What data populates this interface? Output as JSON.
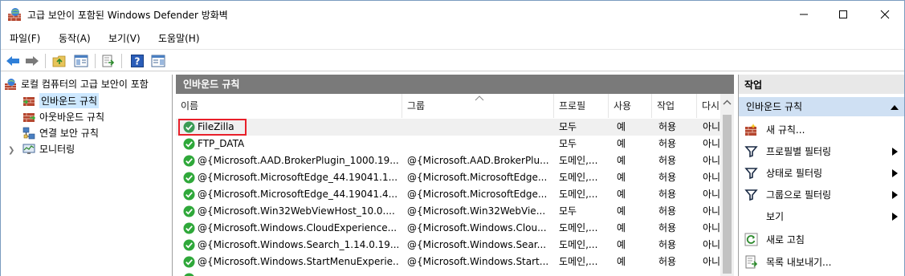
{
  "window": {
    "title": "고급 보안이 포함된 Windows Defender 방화벽"
  },
  "menu": [
    "파일(F)",
    "동작(A)",
    "보기(V)",
    "도움말(H)"
  ],
  "tree": {
    "root": "로컬 컴퓨터의 고급 보안이 포함",
    "items": [
      "인바운드 규칙",
      "아웃바운드 규칙",
      "연결 보안 규칙",
      "모니터링"
    ]
  },
  "center": {
    "header": "인바운드 규칙",
    "columns": [
      "이름",
      "그룹",
      "프로필",
      "사용",
      "작업",
      "다시"
    ],
    "rows": [
      {
        "name": "FileZilla",
        "group": "",
        "profile": "모두",
        "enabled": "예",
        "action": "허용",
        "override": "아니"
      },
      {
        "name": "FTP_DATA",
        "group": "",
        "profile": "모두",
        "enabled": "예",
        "action": "허용",
        "override": "아니"
      },
      {
        "name": "@{Microsoft.AAD.BrokerPlugin_1000.19...",
        "group": "@{Microsoft.AAD.BrokerPlu...",
        "profile": "도메인,...",
        "enabled": "예",
        "action": "허용",
        "override": "아니"
      },
      {
        "name": "@{Microsoft.MicrosoftEdge_44.19041.1....",
        "group": "@{Microsoft.MicrosoftEdge...",
        "profile": "도메인,...",
        "enabled": "예",
        "action": "허용",
        "override": "아니"
      },
      {
        "name": "@{Microsoft.MicrosoftEdge_44.19041.4....",
        "group": "@{Microsoft.MicrosoftEdge...",
        "profile": "도메인,...",
        "enabled": "예",
        "action": "허용",
        "override": "아니"
      },
      {
        "name": "@{Microsoft.Win32WebViewHost_10.0....",
        "group": "@{Microsoft.Win32WebVie...",
        "profile": "모두",
        "enabled": "예",
        "action": "허용",
        "override": "아니"
      },
      {
        "name": "@{Microsoft.Windows.CloudExperience...",
        "group": "@{Microsoft.Windows.Clou...",
        "profile": "도메인,...",
        "enabled": "예",
        "action": "허용",
        "override": "아니"
      },
      {
        "name": "@{Microsoft.Windows.Search_1.14.0.19...",
        "group": "@{Microsoft.Windows.Sear...",
        "profile": "도메인,...",
        "enabled": "예",
        "action": "허용",
        "override": "아니"
      },
      {
        "name": "@{Microsoft.Windows.StartMenuExperie...",
        "group": "@{Microsoft.Windows.Start...",
        "profile": "도메인,...",
        "enabled": "예",
        "action": "허용",
        "override": "아니"
      }
    ]
  },
  "actions": {
    "header": "작업",
    "section": "인바운드 규칙",
    "items": [
      "새 규칙...",
      "프로필별 필터링",
      "상태로 필터링",
      "그룹으로 필터링",
      "보기",
      "새로 고침",
      "목록 내보내기..."
    ]
  }
}
